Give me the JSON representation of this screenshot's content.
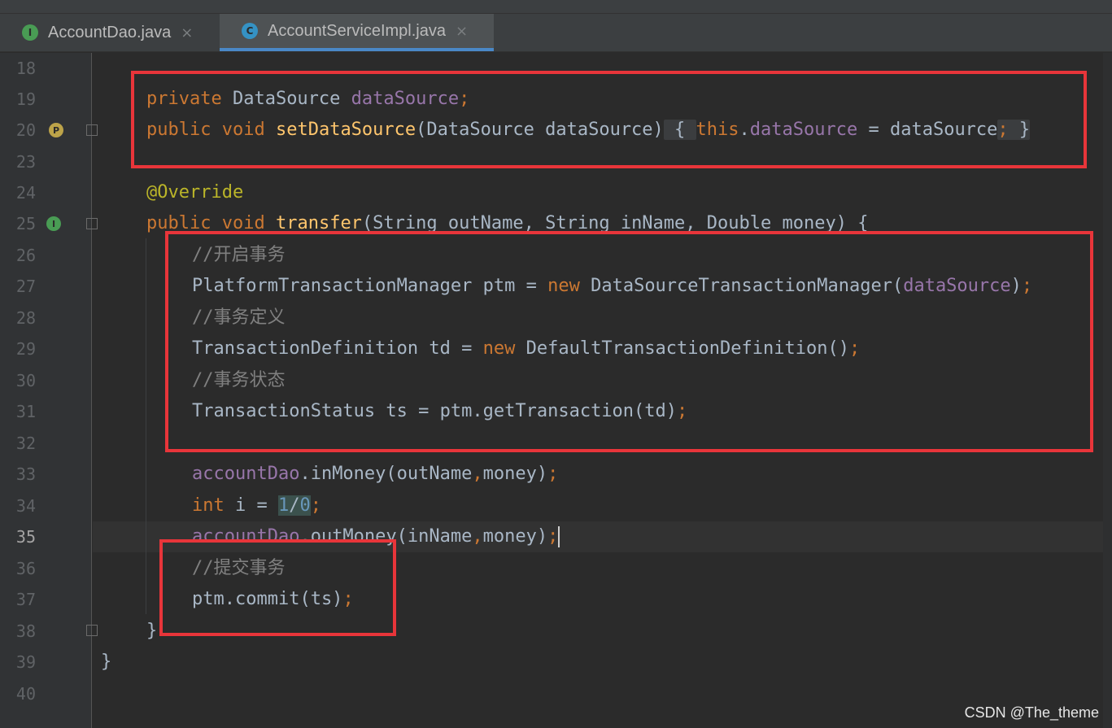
{
  "tabs": [
    {
      "label": "AccountDao.java",
      "icon_letter": "I",
      "icon_color": "#499c54",
      "close": "×"
    },
    {
      "label": "AccountServiceImpl.java",
      "icon_letter": "C",
      "icon_color": "#3592c4",
      "close": "×"
    }
  ],
  "gutter": {
    "line_numbers": [
      "18",
      "19",
      "20",
      "23",
      "24",
      "25",
      "26",
      "27",
      "28",
      "29",
      "30",
      "31",
      "32",
      "33",
      "34",
      "35",
      "36",
      "37",
      "38",
      "39",
      "40"
    ],
    "current_line": "35",
    "icons": {
      "line20": "P",
      "line25": "I"
    }
  },
  "code": {
    "l19": {
      "kw": "private",
      "type": " DataSource ",
      "field": "dataSource",
      "semi": ";"
    },
    "l20": {
      "kw1": "public",
      "kw2": "void",
      "method": "setDataSource",
      "params": "(DataSource dataSource)",
      "brace_open": "{",
      "this": "this",
      "dot": ".",
      "field": "dataSource",
      "assign": " = dataSource",
      "semi": ";",
      "brace_close": "}"
    },
    "l24": {
      "annotation": "@Override"
    },
    "l25": {
      "kw1": "public",
      "kw2": "void",
      "method": "transfer",
      "params": "(String outName, String inName, Double money) {"
    },
    "l26": {
      "comment": "//开启事务"
    },
    "l27": {
      "type": "PlatformTransactionManager ptm = ",
      "kw": "new",
      "ctor": " DataSourceTransactionManager(",
      "field": "dataSource",
      "end": ")",
      "semi": ";"
    },
    "l28": {
      "comment": "//事务定义"
    },
    "l29": {
      "type": "TransactionDefinition td = ",
      "kw": "new",
      "ctor": " DefaultTransactionDefinition()",
      "semi": ";"
    },
    "l30": {
      "comment": "//事务状态"
    },
    "l31": {
      "text": "TransactionStatus ts = ptm.getTransaction(td)",
      "semi": ";"
    },
    "l33": {
      "field": "accountDao",
      "call": ".inMoney(outName",
      "comma": ",",
      "arg": "money)",
      "semi": ";"
    },
    "l34": {
      "kw": "int",
      "var": " i = ",
      "n1": "1",
      "slash": "/",
      "n0": "0",
      "semi": ";"
    },
    "l35": {
      "field": "accountDao",
      "call": ".outMoney(inName",
      "comma": ",",
      "arg": "money)",
      "semi": ";"
    },
    "l36": {
      "comment": "//提交事务"
    },
    "l37": {
      "text": "ptm.commit(ts)",
      "semi": ";"
    },
    "l38": {
      "brace": "}"
    },
    "l39": {
      "brace": "}"
    }
  },
  "watermark": "CSDN @The_theme",
  "colors": {
    "background": "#2b2b2b",
    "keyword": "#cc7832",
    "field": "#9876aa",
    "method": "#ffc66d",
    "annotation": "#bbb529",
    "comment": "#808080",
    "number": "#6897bb",
    "highlight_box": "#e8353a"
  }
}
